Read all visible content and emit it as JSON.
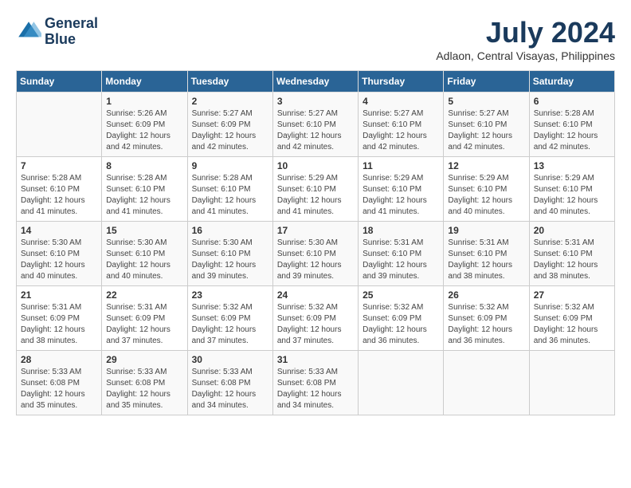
{
  "header": {
    "logo_line1": "General",
    "logo_line2": "Blue",
    "month_year": "July 2024",
    "location": "Adlaon, Central Visayas, Philippines"
  },
  "weekdays": [
    "Sunday",
    "Monday",
    "Tuesday",
    "Wednesday",
    "Thursday",
    "Friday",
    "Saturday"
  ],
  "weeks": [
    [
      {
        "day": "",
        "info": ""
      },
      {
        "day": "1",
        "info": "Sunrise: 5:26 AM\nSunset: 6:09 PM\nDaylight: 12 hours\nand 42 minutes."
      },
      {
        "day": "2",
        "info": "Sunrise: 5:27 AM\nSunset: 6:09 PM\nDaylight: 12 hours\nand 42 minutes."
      },
      {
        "day": "3",
        "info": "Sunrise: 5:27 AM\nSunset: 6:10 PM\nDaylight: 12 hours\nand 42 minutes."
      },
      {
        "day": "4",
        "info": "Sunrise: 5:27 AM\nSunset: 6:10 PM\nDaylight: 12 hours\nand 42 minutes."
      },
      {
        "day": "5",
        "info": "Sunrise: 5:27 AM\nSunset: 6:10 PM\nDaylight: 12 hours\nand 42 minutes."
      },
      {
        "day": "6",
        "info": "Sunrise: 5:28 AM\nSunset: 6:10 PM\nDaylight: 12 hours\nand 42 minutes."
      }
    ],
    [
      {
        "day": "7",
        "info": "Sunrise: 5:28 AM\nSunset: 6:10 PM\nDaylight: 12 hours\nand 41 minutes."
      },
      {
        "day": "8",
        "info": "Sunrise: 5:28 AM\nSunset: 6:10 PM\nDaylight: 12 hours\nand 41 minutes."
      },
      {
        "day": "9",
        "info": "Sunrise: 5:28 AM\nSunset: 6:10 PM\nDaylight: 12 hours\nand 41 minutes."
      },
      {
        "day": "10",
        "info": "Sunrise: 5:29 AM\nSunset: 6:10 PM\nDaylight: 12 hours\nand 41 minutes."
      },
      {
        "day": "11",
        "info": "Sunrise: 5:29 AM\nSunset: 6:10 PM\nDaylight: 12 hours\nand 41 minutes."
      },
      {
        "day": "12",
        "info": "Sunrise: 5:29 AM\nSunset: 6:10 PM\nDaylight: 12 hours\nand 40 minutes."
      },
      {
        "day": "13",
        "info": "Sunrise: 5:29 AM\nSunset: 6:10 PM\nDaylight: 12 hours\nand 40 minutes."
      }
    ],
    [
      {
        "day": "14",
        "info": "Sunrise: 5:30 AM\nSunset: 6:10 PM\nDaylight: 12 hours\nand 40 minutes."
      },
      {
        "day": "15",
        "info": "Sunrise: 5:30 AM\nSunset: 6:10 PM\nDaylight: 12 hours\nand 40 minutes."
      },
      {
        "day": "16",
        "info": "Sunrise: 5:30 AM\nSunset: 6:10 PM\nDaylight: 12 hours\nand 39 minutes."
      },
      {
        "day": "17",
        "info": "Sunrise: 5:30 AM\nSunset: 6:10 PM\nDaylight: 12 hours\nand 39 minutes."
      },
      {
        "day": "18",
        "info": "Sunrise: 5:31 AM\nSunset: 6:10 PM\nDaylight: 12 hours\nand 39 minutes."
      },
      {
        "day": "19",
        "info": "Sunrise: 5:31 AM\nSunset: 6:10 PM\nDaylight: 12 hours\nand 38 minutes."
      },
      {
        "day": "20",
        "info": "Sunrise: 5:31 AM\nSunset: 6:10 PM\nDaylight: 12 hours\nand 38 minutes."
      }
    ],
    [
      {
        "day": "21",
        "info": "Sunrise: 5:31 AM\nSunset: 6:09 PM\nDaylight: 12 hours\nand 38 minutes."
      },
      {
        "day": "22",
        "info": "Sunrise: 5:31 AM\nSunset: 6:09 PM\nDaylight: 12 hours\nand 37 minutes."
      },
      {
        "day": "23",
        "info": "Sunrise: 5:32 AM\nSunset: 6:09 PM\nDaylight: 12 hours\nand 37 minutes."
      },
      {
        "day": "24",
        "info": "Sunrise: 5:32 AM\nSunset: 6:09 PM\nDaylight: 12 hours\nand 37 minutes."
      },
      {
        "day": "25",
        "info": "Sunrise: 5:32 AM\nSunset: 6:09 PM\nDaylight: 12 hours\nand 36 minutes."
      },
      {
        "day": "26",
        "info": "Sunrise: 5:32 AM\nSunset: 6:09 PM\nDaylight: 12 hours\nand 36 minutes."
      },
      {
        "day": "27",
        "info": "Sunrise: 5:32 AM\nSunset: 6:09 PM\nDaylight: 12 hours\nand 36 minutes."
      }
    ],
    [
      {
        "day": "28",
        "info": "Sunrise: 5:33 AM\nSunset: 6:08 PM\nDaylight: 12 hours\nand 35 minutes."
      },
      {
        "day": "29",
        "info": "Sunrise: 5:33 AM\nSunset: 6:08 PM\nDaylight: 12 hours\nand 35 minutes."
      },
      {
        "day": "30",
        "info": "Sunrise: 5:33 AM\nSunset: 6:08 PM\nDaylight: 12 hours\nand 34 minutes."
      },
      {
        "day": "31",
        "info": "Sunrise: 5:33 AM\nSunset: 6:08 PM\nDaylight: 12 hours\nand 34 minutes."
      },
      {
        "day": "",
        "info": ""
      },
      {
        "day": "",
        "info": ""
      },
      {
        "day": "",
        "info": ""
      }
    ]
  ]
}
